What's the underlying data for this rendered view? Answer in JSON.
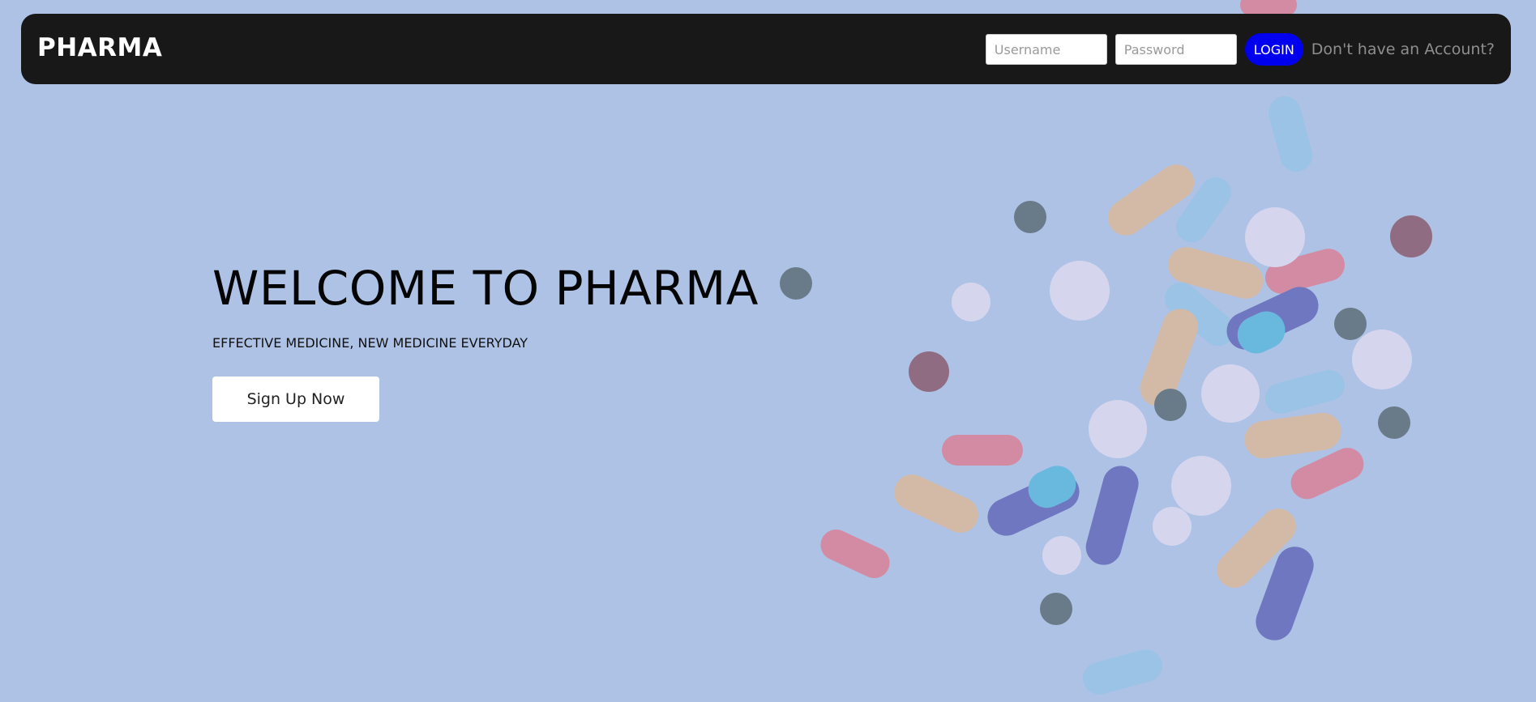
{
  "navbar": {
    "brand": "PHARMA",
    "username_placeholder": "Username",
    "password_placeholder": "Password",
    "login_label": "LOGIN",
    "signup_link": "Don't have an Account?"
  },
  "hero": {
    "title": "WELCOME TO PHARMA",
    "subtitle": "EFFECTIVE MEDICINE, NEW MEDICINE EVERYDAY",
    "cta_label": "Sign Up Now"
  },
  "colors": {
    "background": "#aec2e6",
    "navbar": "#181818",
    "login_button": "#0000ee"
  },
  "icons": [
    "pills-background-image"
  ]
}
